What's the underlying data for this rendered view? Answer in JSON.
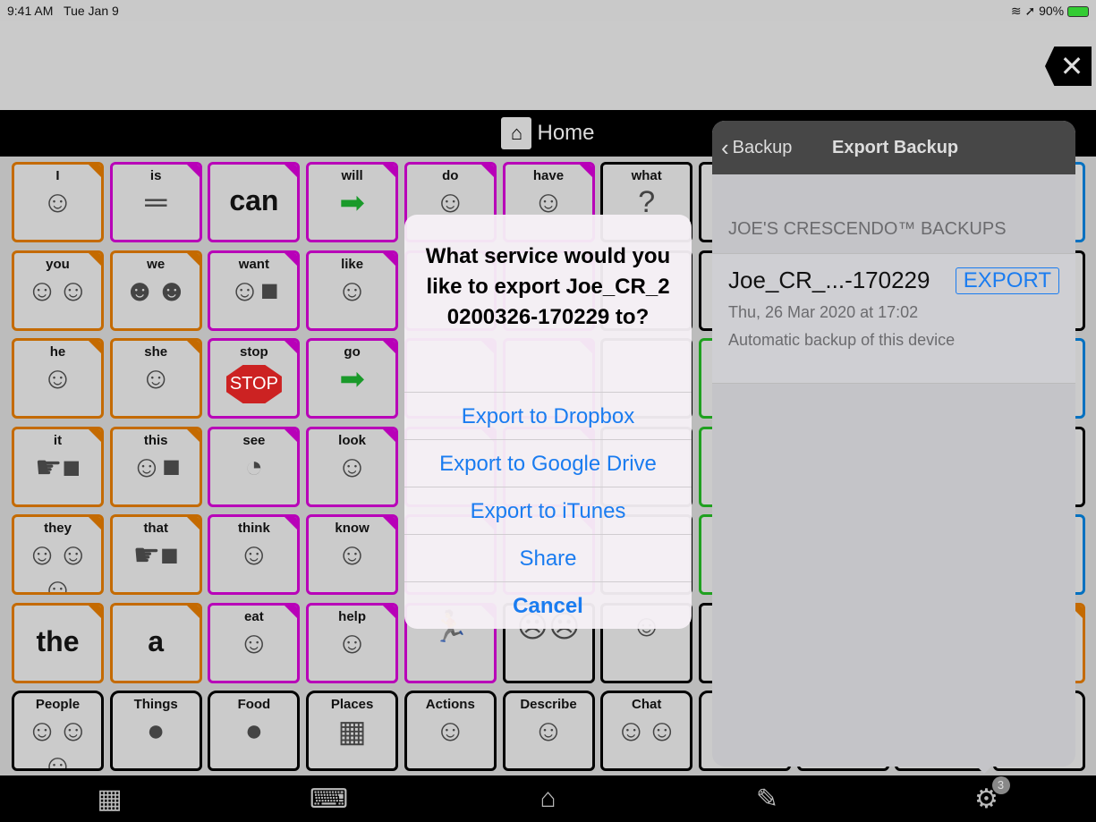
{
  "status": {
    "time": "9:41 AM",
    "date": "Tue Jan 9",
    "battery": "90%",
    "icons": [
      "wifi-icon",
      "location-icon",
      "battery-charging-icon"
    ]
  },
  "title": {
    "label": "Home",
    "icon": "home-icon"
  },
  "grid": [
    [
      {
        "t": "I",
        "c": "or",
        "p": "☺"
      },
      {
        "t": "is",
        "c": "mg",
        "p": "═"
      },
      {
        "t": "can",
        "c": "mg",
        "big": true
      },
      {
        "t": "will",
        "c": "mg",
        "p": "➡"
      },
      {
        "t": "do",
        "c": "mg",
        "p": "☺"
      },
      {
        "t": "have",
        "c": "mg",
        "p": "☺"
      },
      {
        "t": "what",
        "c": "bk",
        "p": "?"
      },
      {
        "t": "",
        "c": "bk"
      },
      {
        "t": "",
        "c": "bk"
      },
      {
        "t": "",
        "c": "bk"
      },
      {
        "t": "",
        "c": "bl"
      }
    ],
    [
      {
        "t": "you",
        "c": "or",
        "p": "☺☺"
      },
      {
        "t": "we",
        "c": "or",
        "p": "☻☻"
      },
      {
        "t": "want",
        "c": "mg",
        "p": "☺■"
      },
      {
        "t": "like",
        "c": "mg",
        "p": "☺"
      },
      {
        "t": "",
        "c": "mg"
      },
      {
        "t": "",
        "c": "mg"
      },
      {
        "t": "",
        "c": "bk"
      },
      {
        "t": "",
        "c": "bk"
      },
      {
        "t": "",
        "c": "bk"
      },
      {
        "t": "",
        "c": "bk"
      },
      {
        "t": "",
        "c": "bk"
      }
    ],
    [
      {
        "t": "he",
        "c": "or",
        "p": "☺"
      },
      {
        "t": "she",
        "c": "or",
        "p": "☺"
      },
      {
        "t": "stop",
        "c": "mg",
        "p": "STOP"
      },
      {
        "t": "go",
        "c": "mg",
        "p": "➡"
      },
      {
        "t": "",
        "c": "mg"
      },
      {
        "t": "",
        "c": "mg"
      },
      {
        "t": "",
        "c": "bk"
      },
      {
        "t": "",
        "c": "gr"
      },
      {
        "t": "",
        "c": "bk"
      },
      {
        "t": "",
        "c": "bk"
      },
      {
        "t": "",
        "c": "bl"
      }
    ],
    [
      {
        "t": "it",
        "c": "or",
        "p": "☛■"
      },
      {
        "t": "this",
        "c": "or",
        "p": "☺■"
      },
      {
        "t": "see",
        "c": "mg",
        "p": "◔"
      },
      {
        "t": "look",
        "c": "mg",
        "p": "☺"
      },
      {
        "t": "",
        "c": "mg"
      },
      {
        "t": "",
        "c": "mg"
      },
      {
        "t": "",
        "c": "bk"
      },
      {
        "t": "",
        "c": "gr"
      },
      {
        "t": "",
        "c": "bk"
      },
      {
        "t": "",
        "c": "bk"
      },
      {
        "t": "",
        "c": "bk"
      }
    ],
    [
      {
        "t": "they",
        "c": "or",
        "p": "☺☺☺"
      },
      {
        "t": "that",
        "c": "or",
        "p": "☛■"
      },
      {
        "t": "think",
        "c": "mg",
        "p": "☺"
      },
      {
        "t": "know",
        "c": "mg",
        "p": "☺"
      },
      {
        "t": "",
        "c": "mg"
      },
      {
        "t": "",
        "c": "mg"
      },
      {
        "t": "",
        "c": "bk"
      },
      {
        "t": "",
        "c": "gr"
      },
      {
        "t": "",
        "c": "bk"
      },
      {
        "t": "",
        "c": "bk"
      },
      {
        "t": "",
        "c": "bl"
      }
    ],
    [
      {
        "t": "the",
        "c": "or",
        "big": true
      },
      {
        "t": "a",
        "c": "or",
        "big": true
      },
      {
        "t": "eat",
        "c": "mg",
        "p": "☺"
      },
      {
        "t": "help",
        "c": "mg",
        "p": "☺"
      },
      {
        "t": "",
        "c": "mg",
        "p": "🏃"
      },
      {
        "t": "",
        "c": "bk",
        "p": "☹☹"
      },
      {
        "t": "",
        "c": "bk",
        "p": "☺"
      },
      {
        "t": "",
        "c": "bk"
      },
      {
        "t": "",
        "c": "bk"
      },
      {
        "t": "",
        "c": "bk"
      },
      {
        "t": "",
        "c": "or"
      }
    ],
    [
      {
        "t": "People",
        "c": "bk",
        "f": true,
        "p": "☺☺☺"
      },
      {
        "t": "Things",
        "c": "bk",
        "f": true,
        "p": "●"
      },
      {
        "t": "Food",
        "c": "bk",
        "f": true,
        "p": "●"
      },
      {
        "t": "Places",
        "c": "bk",
        "f": true,
        "p": "▦"
      },
      {
        "t": "Actions",
        "c": "bk",
        "f": true,
        "p": "☺"
      },
      {
        "t": "Describe",
        "c": "bk",
        "f": true,
        "p": "☺"
      },
      {
        "t": "Chat",
        "c": "bk",
        "f": true,
        "p": "☺☺"
      },
      {
        "t": "",
        "c": "bk",
        "f": true
      },
      {
        "t": "",
        "c": "bk",
        "f": true
      },
      {
        "t": "",
        "c": "bk",
        "f": true
      },
      {
        "t": "",
        "c": "bk",
        "f": true
      }
    ]
  ],
  "dialog": {
    "title": "What service would you like to export Joe_CR_20200326-170229 to?",
    "options": [
      "Export to Dropbox",
      "Export to Google Drive",
      "Export to iTunes",
      "Share"
    ],
    "cancel": "Cancel"
  },
  "panel": {
    "back": "Backup",
    "title": "Export Backup",
    "section": "JOE'S CRESCENDO™ BACKUPS",
    "item": {
      "name": "Joe_CR_...-170229",
      "button": "EXPORT",
      "date": "Thu, 26 Mar 2020 at 17:02",
      "desc": "Automatic backup of this device"
    }
  },
  "toolbar": {
    "items": [
      "grid-icon",
      "keyboard-icon",
      "home-icon",
      "pencil-icon",
      "gear-icon"
    ],
    "badge": "3"
  }
}
